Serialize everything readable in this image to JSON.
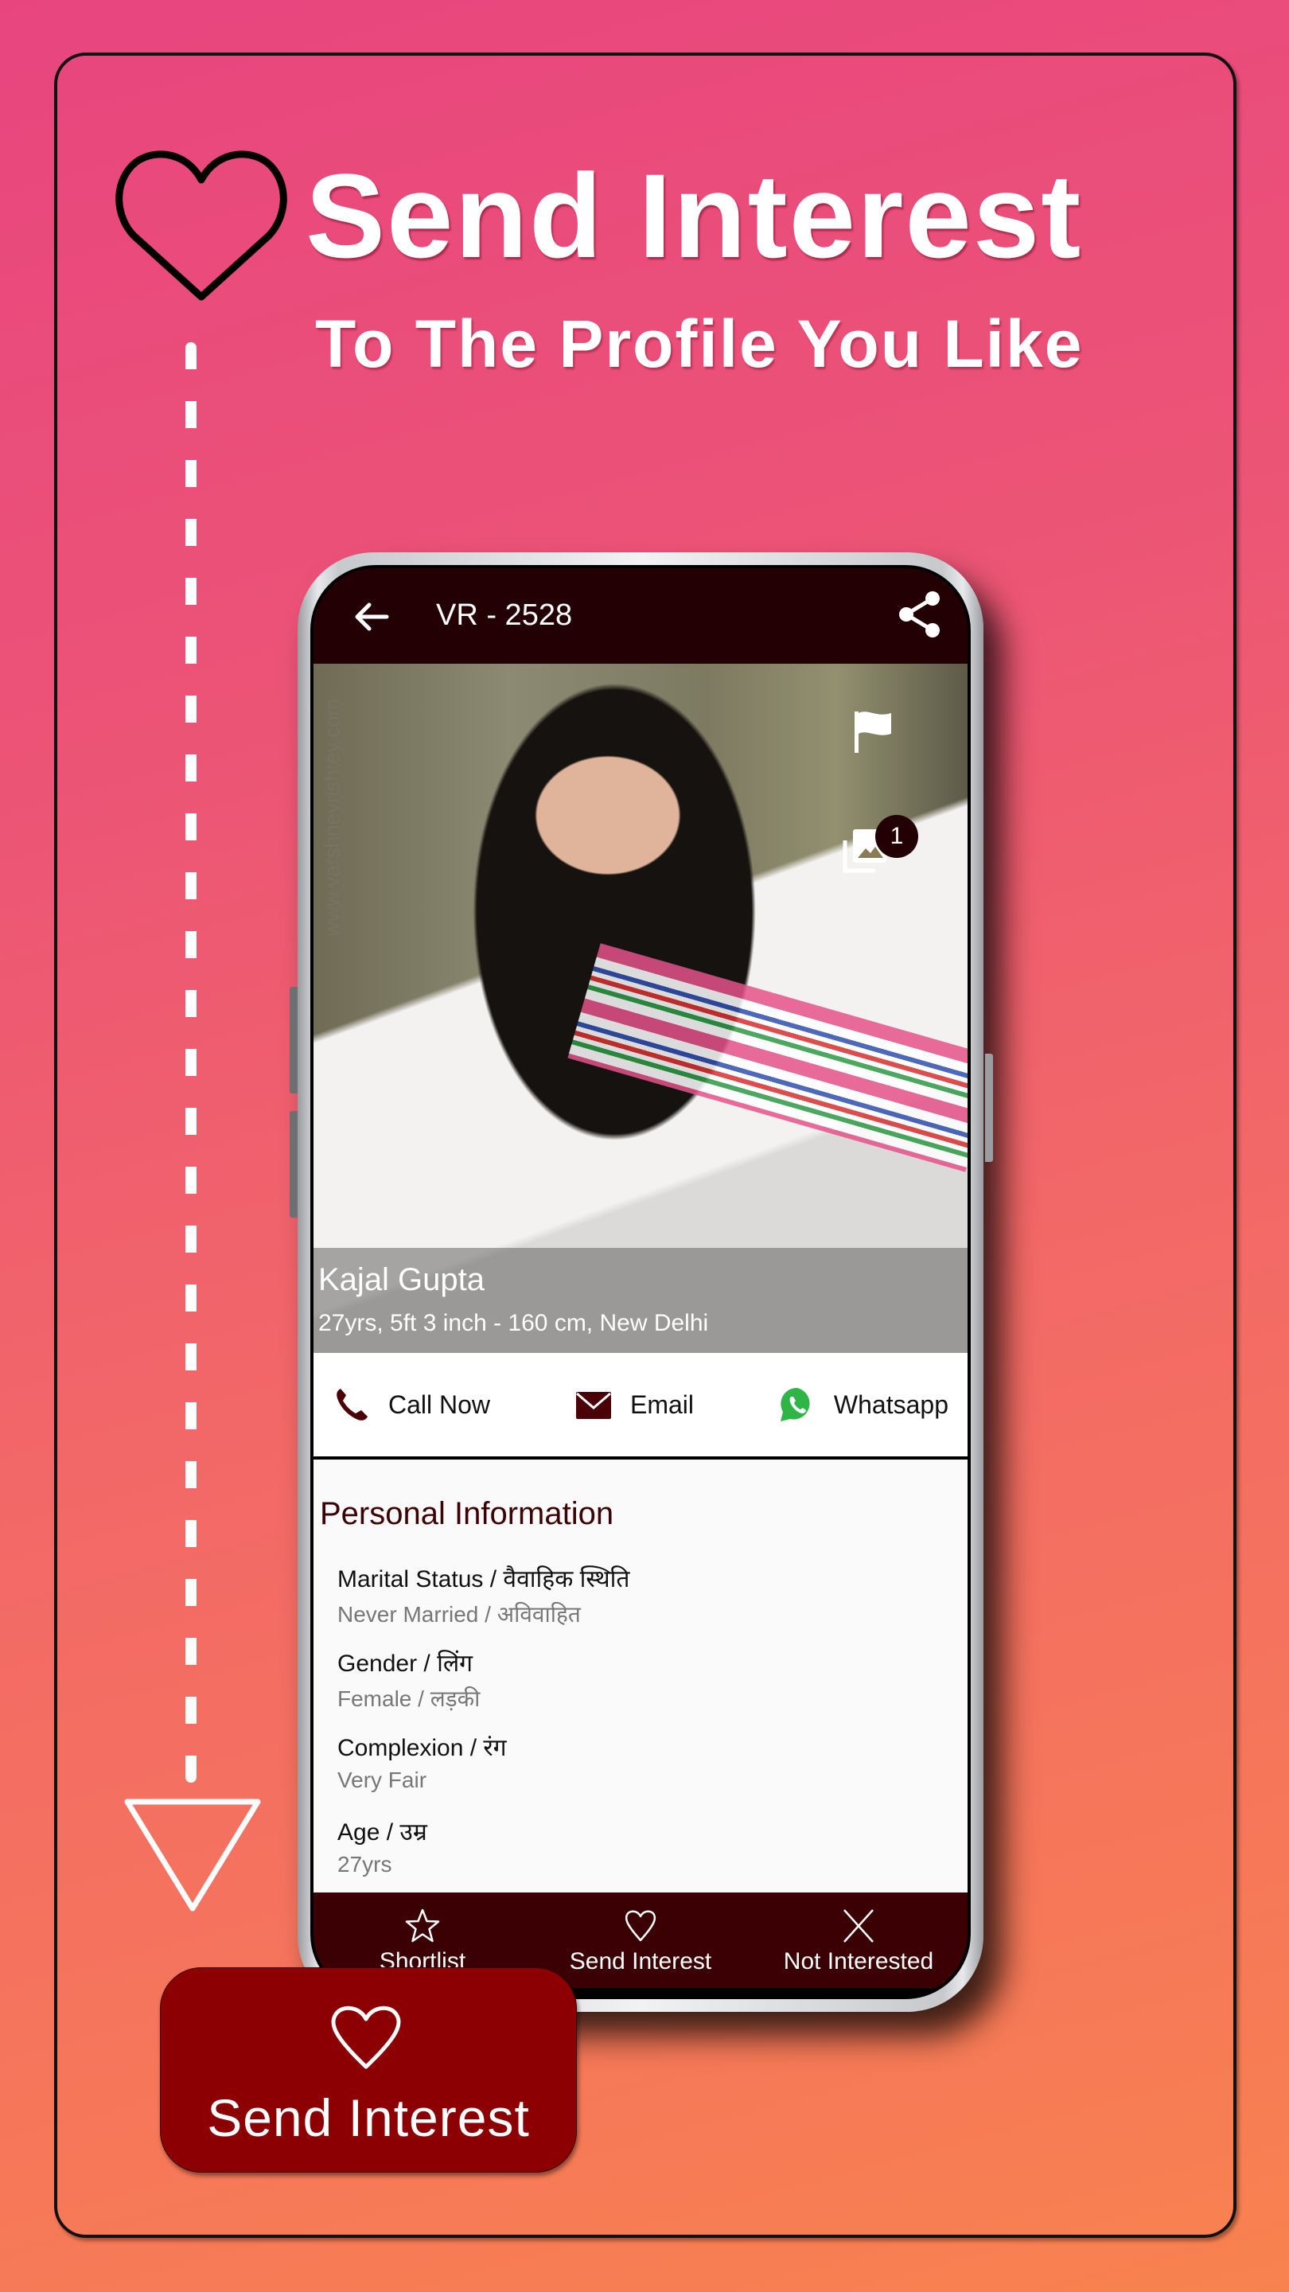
{
  "banner": {
    "title": "Send Interest",
    "subtitle": "To The Profile You Like"
  },
  "app": {
    "profile_id": "VR - 2528",
    "watermark": "www.varshneyrishtey.com",
    "gallery_count": "1",
    "profile": {
      "name": "Kajal Gupta",
      "summary": "27yrs, 5ft 3 inch - 160 cm, New Delhi"
    },
    "contact_actions": [
      {
        "label": "Call Now",
        "icon": "phone-icon"
      },
      {
        "label": "Email",
        "icon": "email-icon"
      },
      {
        "label": "Whatsapp",
        "icon": "whatsapp-icon"
      }
    ],
    "personal_info": {
      "title": "Personal Information",
      "fields": [
        {
          "label": "Marital Status / वैवाहिक स्थिति",
          "value": "Never Married / अविवाहित"
        },
        {
          "label": "Gender / लिंग",
          "value": "Female / लड़की"
        },
        {
          "label": "Complexion / रंग",
          "value": "Very Fair"
        },
        {
          "label": "Age / उम्र",
          "value": "27yrs"
        }
      ]
    },
    "bottom_nav": [
      {
        "label": "Shortlist",
        "icon": "star-icon"
      },
      {
        "label": "Send Interest",
        "icon": "heart-icon"
      },
      {
        "label": "Not Interested",
        "icon": "close-icon"
      }
    ]
  },
  "cta": {
    "label": "Send Interest",
    "icon": "heart-icon"
  },
  "colors": {
    "appbar": "#230003",
    "bottom_nav": "#3a0004",
    "cta": "#8c0003",
    "section_title": "#3d0005",
    "whatsapp": "#2fb545"
  }
}
